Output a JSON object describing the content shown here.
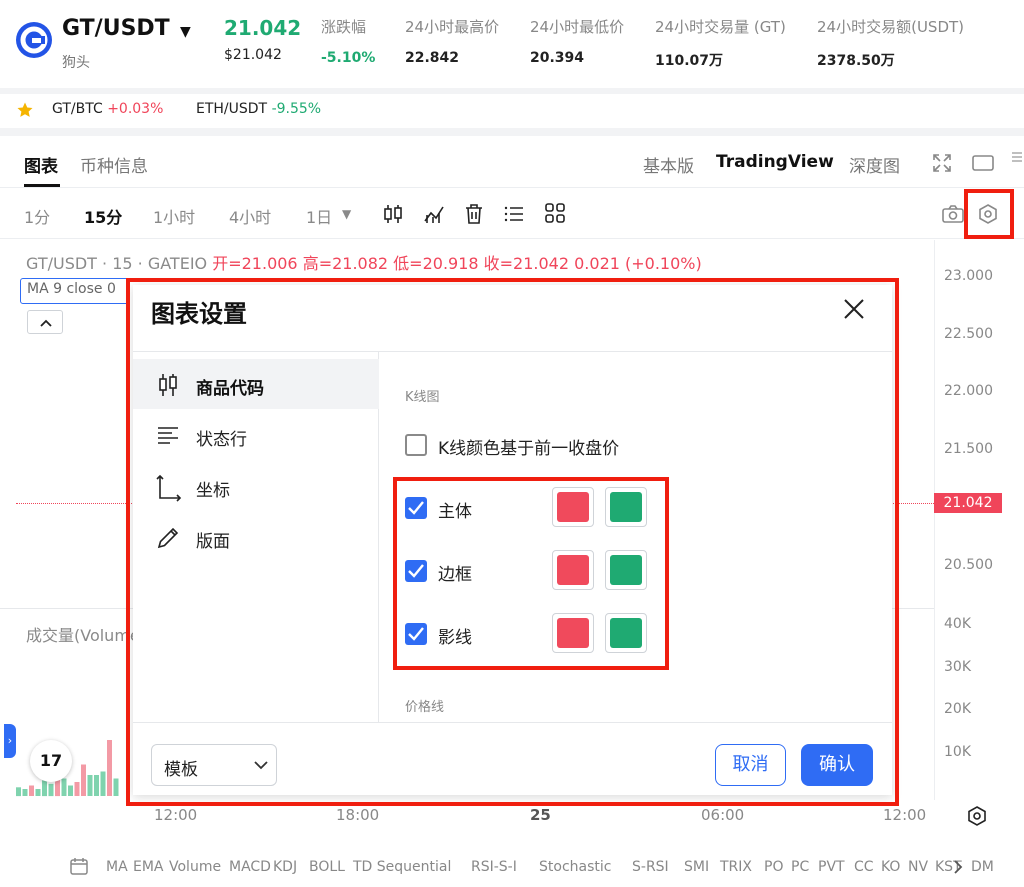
{
  "header": {
    "pair": "GT/USDT",
    "pair_caret": "▼",
    "subtitle": "狗头",
    "last_price": "21.042",
    "last_price_usd": "$21.042",
    "stats": [
      {
        "label": "涨跌幅",
        "value": "-5.10%"
      },
      {
        "label": "24小时最高价",
        "value": "22.842"
      },
      {
        "label": "24小时最低价",
        "value": "20.394"
      },
      {
        "label": "24小时交易量 (GT)",
        "value": "110.07万"
      },
      {
        "label": "24小时交易额(USDT)",
        "value": "2378.50万"
      }
    ]
  },
  "favorites": [
    {
      "symbol": "GT/BTC",
      "change": "+0.03%"
    },
    {
      "symbol": "ETH/USDT",
      "change": "-9.55%"
    }
  ],
  "tabs": [
    {
      "label": "图表"
    },
    {
      "label": "币种信息"
    }
  ],
  "modes": [
    {
      "label": "基本版"
    },
    {
      "label": "TradingView"
    },
    {
      "label": "深度图"
    }
  ],
  "timeframes": [
    {
      "label": "1分"
    },
    {
      "label": "15分"
    },
    {
      "label": "1小时"
    },
    {
      "label": "4小时"
    },
    {
      "label": "1日"
    }
  ],
  "timeframe_caret": "▼",
  "chart": {
    "legend_prefix": "GT/USDT · 15 · GATEIO",
    "legend_ohlc": "开=21.006  高=21.082  低=20.918  收=21.042  0.021 (+0.10%)",
    "ma_chip": "MA 9 close 0",
    "price_labels": [
      "23.000",
      "22.500",
      "22.000",
      "21.500",
      "20.500"
    ],
    "current_price_tag": "21.042",
    "volume_label": "成交量(Volume",
    "volume_labels": [
      "40K",
      "30K",
      "20K",
      "10K"
    ],
    "time_labels": [
      "12:00",
      "18:00",
      "25",
      "06:00",
      "12:00"
    ],
    "tv_logo": "17",
    "volume_bars": [
      {
        "v": 2.5,
        "up": true
      },
      {
        "v": 2.0,
        "up": true
      },
      {
        "v": 3.0,
        "up": false
      },
      {
        "v": 2.0,
        "up": true
      },
      {
        "v": 4.5,
        "up": true
      },
      {
        "v": 3.5,
        "up": true
      },
      {
        "v": 6.5,
        "up": false
      },
      {
        "v": 5.0,
        "up": true
      },
      {
        "v": 3.0,
        "up": true
      },
      {
        "v": 4.0,
        "up": false
      },
      {
        "v": 9.0,
        "up": false
      },
      {
        "v": 6.0,
        "up": true
      },
      {
        "v": 6.0,
        "up": true
      },
      {
        "v": 7.0,
        "up": true
      },
      {
        "v": 16.0,
        "up": false
      },
      {
        "v": 5.0,
        "up": true
      }
    ]
  },
  "indicators": [
    "MA",
    "EMA",
    "Volume",
    "MACD",
    "KDJ",
    "BOLL",
    "TD Sequential",
    "RSI-S-I",
    "Stochastic",
    "S-RSI",
    "SMI",
    "TRIX",
    "PO",
    "PC",
    "PVT",
    "CC",
    "KO",
    "NV",
    "KST",
    "DM"
  ],
  "modal": {
    "title": "图表设置",
    "sidebar": [
      {
        "label": "商品代码",
        "icon": "candlestick-icon"
      },
      {
        "label": "状态行",
        "icon": "lines-icon"
      },
      {
        "label": "坐标",
        "icon": "axis-icon"
      },
      {
        "label": "版面",
        "icon": "pencil-icon"
      }
    ],
    "section_kline": "K线图",
    "prev_close_label": "K线颜色基于前一收盘价",
    "rows": [
      {
        "label": "主体",
        "checked": true
      },
      {
        "label": "边框",
        "checked": true
      },
      {
        "label": "影线",
        "checked": true
      }
    ],
    "section_price_line": "价格线",
    "template_label": "模板",
    "cancel_label": "取消",
    "ok_label": "确认"
  },
  "colors": {
    "up": "#1faa72",
    "down": "#f0455a",
    "accent": "#2f6cf4",
    "highlight": "#f01e0f",
    "swatch_red": "#f04a5c",
    "swatch_green": "#1faa72"
  }
}
